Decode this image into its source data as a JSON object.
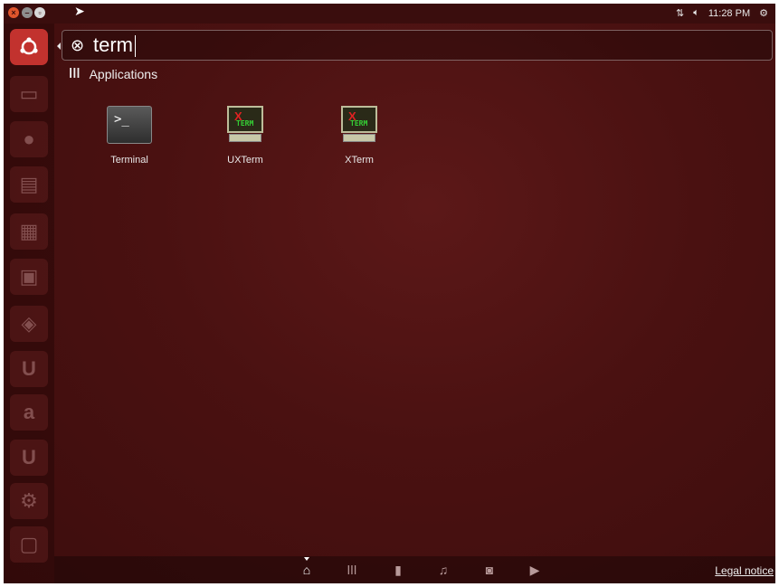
{
  "top_panel": {
    "clock": "11:28 PM",
    "network_icon": "network-updown-icon",
    "sound_icon": "speaker-icon",
    "session_icon": "gear-icon"
  },
  "search": {
    "query": "term"
  },
  "category": {
    "label": "Applications"
  },
  "apps": [
    {
      "name": "Terminal"
    },
    {
      "name": "UXTerm"
    },
    {
      "name": "XTerm"
    }
  ],
  "launcher": {
    "amazon_glyph": "a",
    "ubuntu_one_glyph": "U"
  },
  "bottom": {
    "legal_notice": "Legal notice"
  },
  "colors": {
    "background": "#4a1111",
    "accent": "#c2322e"
  }
}
